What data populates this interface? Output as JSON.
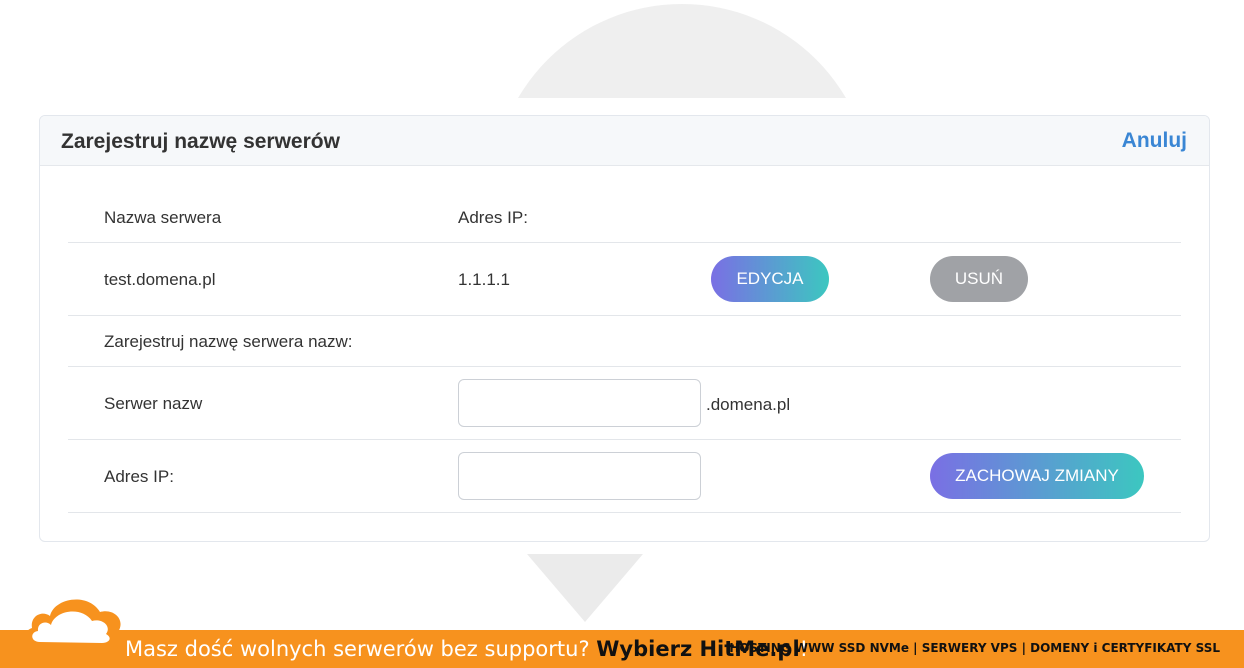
{
  "card": {
    "title": "Zarejestruj nazwę serwerów",
    "cancel_label": "Anuluj"
  },
  "table": {
    "header": {
      "col_name": "Nazwa serwera",
      "col_ip": "Adres IP:"
    },
    "rows": [
      {
        "name": "test.domena.pl",
        "ip": "1.1.1.1",
        "edit_label": "EDYCJA",
        "delete_label": "USUŃ"
      }
    ]
  },
  "register": {
    "section_label": "Zarejestruj nazwę serwera nazw:",
    "ns_label": "Serwer nazw",
    "ns_value": "",
    "ns_suffix": ".domena.pl",
    "ip_label": "Adres IP:",
    "ip_value": "",
    "save_label": "ZACHOWAJ ZMIANY"
  },
  "banner": {
    "text_prefix": "Masz dość wolnych serwerów bez supportu? ",
    "text_strong": "Wybierz HitMe.pl",
    "text_suffix": "!",
    "links": "HOSTING WWW SSD NVMe | SERWERY VPS | DOMENY i CERTYFIKATY SSL"
  },
  "colors": {
    "accent": "#3a86d4",
    "gradient_start": "#7a6fe4",
    "gradient_end": "#3cc7c0",
    "delete_grey": "#a0a2a6",
    "banner_orange": "#f7921e"
  }
}
